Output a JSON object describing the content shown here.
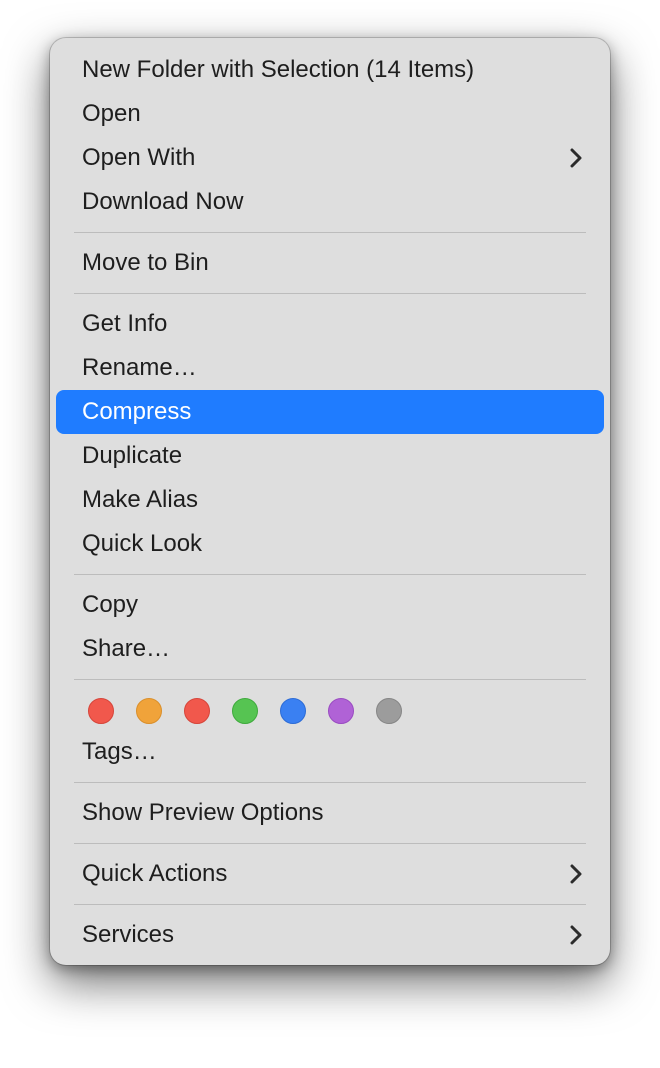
{
  "menu": {
    "items": {
      "new_folder": {
        "label": "New Folder with Selection (14 Items)",
        "submenu": false
      },
      "open": {
        "label": "Open",
        "submenu": false
      },
      "open_with": {
        "label": "Open With",
        "submenu": true
      },
      "download_now": {
        "label": "Download Now",
        "submenu": false
      },
      "move_to_bin": {
        "label": "Move to Bin",
        "submenu": false
      },
      "get_info": {
        "label": "Get Info",
        "submenu": false
      },
      "rename": {
        "label": "Rename…",
        "submenu": false
      },
      "compress": {
        "label": "Compress",
        "submenu": false,
        "highlighted": true
      },
      "duplicate": {
        "label": "Duplicate",
        "submenu": false
      },
      "make_alias": {
        "label": "Make Alias",
        "submenu": false
      },
      "quick_look": {
        "label": "Quick Look",
        "submenu": false
      },
      "copy": {
        "label": "Copy",
        "submenu": false
      },
      "share": {
        "label": "Share…",
        "submenu": false
      },
      "tags": {
        "label": "Tags…",
        "submenu": false
      },
      "show_preview_options": {
        "label": "Show Preview Options",
        "submenu": false
      },
      "quick_actions": {
        "label": "Quick Actions",
        "submenu": true
      },
      "services": {
        "label": "Services",
        "submenu": true
      }
    },
    "tag_colors": [
      {
        "name": "red",
        "fill": "#f1584c",
        "border": "#d6453a"
      },
      {
        "name": "orange",
        "fill": "#f0a33a",
        "border": "#da8f2b"
      },
      {
        "name": "red2",
        "fill": "#f1584c",
        "border": "#d6453a"
      },
      {
        "name": "green",
        "fill": "#56c452",
        "border": "#3faa3d"
      },
      {
        "name": "blue",
        "fill": "#3a80f2",
        "border": "#2d6cd6"
      },
      {
        "name": "purple",
        "fill": "#b062d6",
        "border": "#9a4cc2"
      },
      {
        "name": "gray",
        "fill": "#9c9c9c",
        "border": "#868686"
      }
    ]
  },
  "colors": {
    "highlight": "#1f7cff"
  }
}
